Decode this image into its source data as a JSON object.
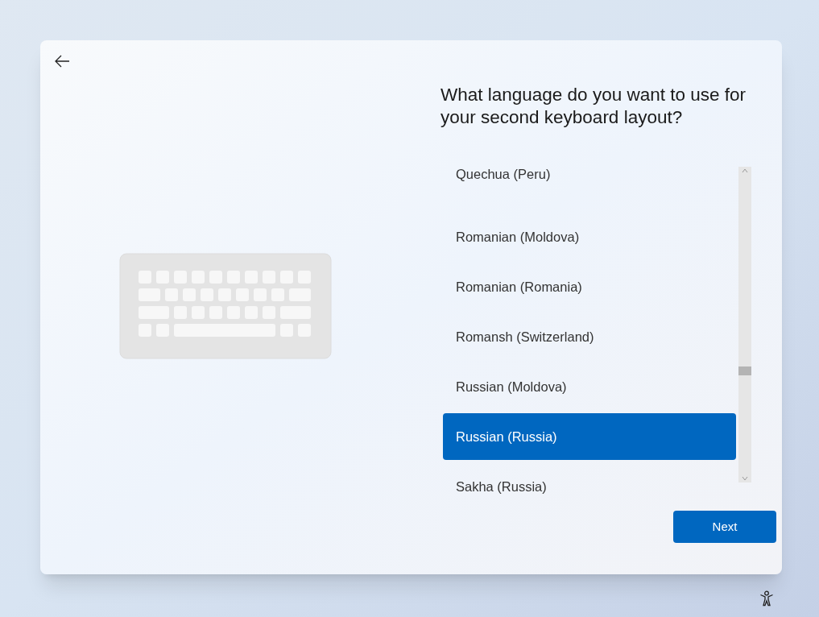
{
  "heading": "What language do you want to use for your second keyboard layout?",
  "languages": [
    {
      "label": "Quechua (Peru)",
      "selected": false
    },
    {
      "label": "Romanian (Moldova)",
      "selected": false
    },
    {
      "label": "Romanian (Romania)",
      "selected": false
    },
    {
      "label": "Romansh (Switzerland)",
      "selected": false
    },
    {
      "label": "Russian (Moldova)",
      "selected": false
    },
    {
      "label": "Russian (Russia)",
      "selected": true
    },
    {
      "label": "Sakha (Russia)",
      "selected": false
    }
  ],
  "next_button": "Next"
}
